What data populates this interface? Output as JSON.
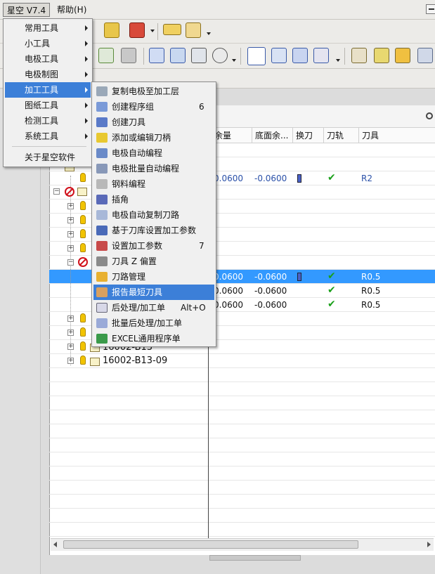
{
  "menubar": {
    "app_menu": "星空 V7.4",
    "help_menu": "帮助(H)"
  },
  "main_menu": {
    "items": [
      {
        "label": "常用工具",
        "has_submenu": true
      },
      {
        "label": "小工具",
        "has_submenu": true
      },
      {
        "label": "电极工具",
        "has_submenu": true
      },
      {
        "label": "电极制图",
        "has_submenu": true
      },
      {
        "label": "加工工具",
        "has_submenu": true,
        "highlighted": true
      },
      {
        "label": "图纸工具",
        "has_submenu": true
      },
      {
        "label": "检测工具",
        "has_submenu": true
      },
      {
        "label": "系统工具",
        "has_submenu": true
      }
    ],
    "about": "关于星空软件"
  },
  "submenu": {
    "items": [
      {
        "label": "复制电极至加工层",
        "shortcut": "",
        "icon": "copy-electrode-icon"
      },
      {
        "label": "创建程序组",
        "shortcut": "6",
        "icon": "program-group-icon"
      },
      {
        "label": "创建刀具",
        "shortcut": "",
        "icon": "create-tool-icon"
      },
      {
        "label": "添加或编辑刀柄",
        "shortcut": "",
        "icon": "tool-holder-icon"
      },
      {
        "label": "电极自动编程",
        "shortcut": "",
        "icon": "electrode-program-icon"
      },
      {
        "label": "电极批量自动编程",
        "shortcut": "",
        "icon": "batch-program-icon"
      },
      {
        "label": "钢料编程",
        "shortcut": "",
        "icon": "steel-program-icon"
      },
      {
        "label": "插角",
        "shortcut": "",
        "icon": "corner-icon"
      },
      {
        "label": "电极自动复制刀路",
        "shortcut": "",
        "icon": "copy-toolpath-icon"
      },
      {
        "label": "基于刀库设置加工参数",
        "shortcut": "",
        "icon": "tool-library-icon"
      },
      {
        "label": "设置加工参数",
        "shortcut": "7",
        "icon": "set-params-icon"
      },
      {
        "label": "刀具 Z 偏置",
        "shortcut": "",
        "icon": "z-offset-icon"
      },
      {
        "label": "刀路管理",
        "shortcut": "",
        "icon": "toolpath-manage-icon"
      },
      {
        "label": "报告最短刀具",
        "shortcut": "",
        "icon": "shortest-tool-icon",
        "highlighted": true
      },
      {
        "label": "后处理/加工单",
        "shortcut": "Alt+O",
        "icon": "postprocess-icon"
      },
      {
        "label": "批量后处理/加工单",
        "shortcut": "",
        "icon": "batch-postprocess-icon"
      },
      {
        "label": "EXCEL通用程序单",
        "shortcut": "",
        "icon": "excel-sheet-icon"
      }
    ]
  },
  "navigator": {
    "columns": [
      "余量",
      "底面余...",
      "换刀",
      "刀轨",
      "刀具"
    ],
    "rows": [
      {
        "allowance": "0.0600",
        "floor": "-0.0600",
        "tool_change": true,
        "path_ok": true,
        "tool": "R2",
        "selected": false
      },
      {
        "allowance": "0.0600",
        "floor": "-0.0600",
        "tool_change": true,
        "path_ok": true,
        "tool": "R0.5",
        "selected": true
      },
      {
        "allowance": "0.0600",
        "floor": "-0.0600",
        "tool_change": false,
        "path_ok": true,
        "tool": "R0.5",
        "selected": false
      },
      {
        "allowance": "0.0600",
        "floor": "-0.0600",
        "tool_change": false,
        "path_ok": true,
        "tool": "R0.5",
        "selected": false
      }
    ],
    "tree_items": [
      "16002-B13",
      "16002-B13-09"
    ]
  },
  "colors": {
    "menu_highlight": "#3c7fd8",
    "row_selected": "#3399ff",
    "check": "#1aa01a",
    "noentry": "#d0101a"
  }
}
